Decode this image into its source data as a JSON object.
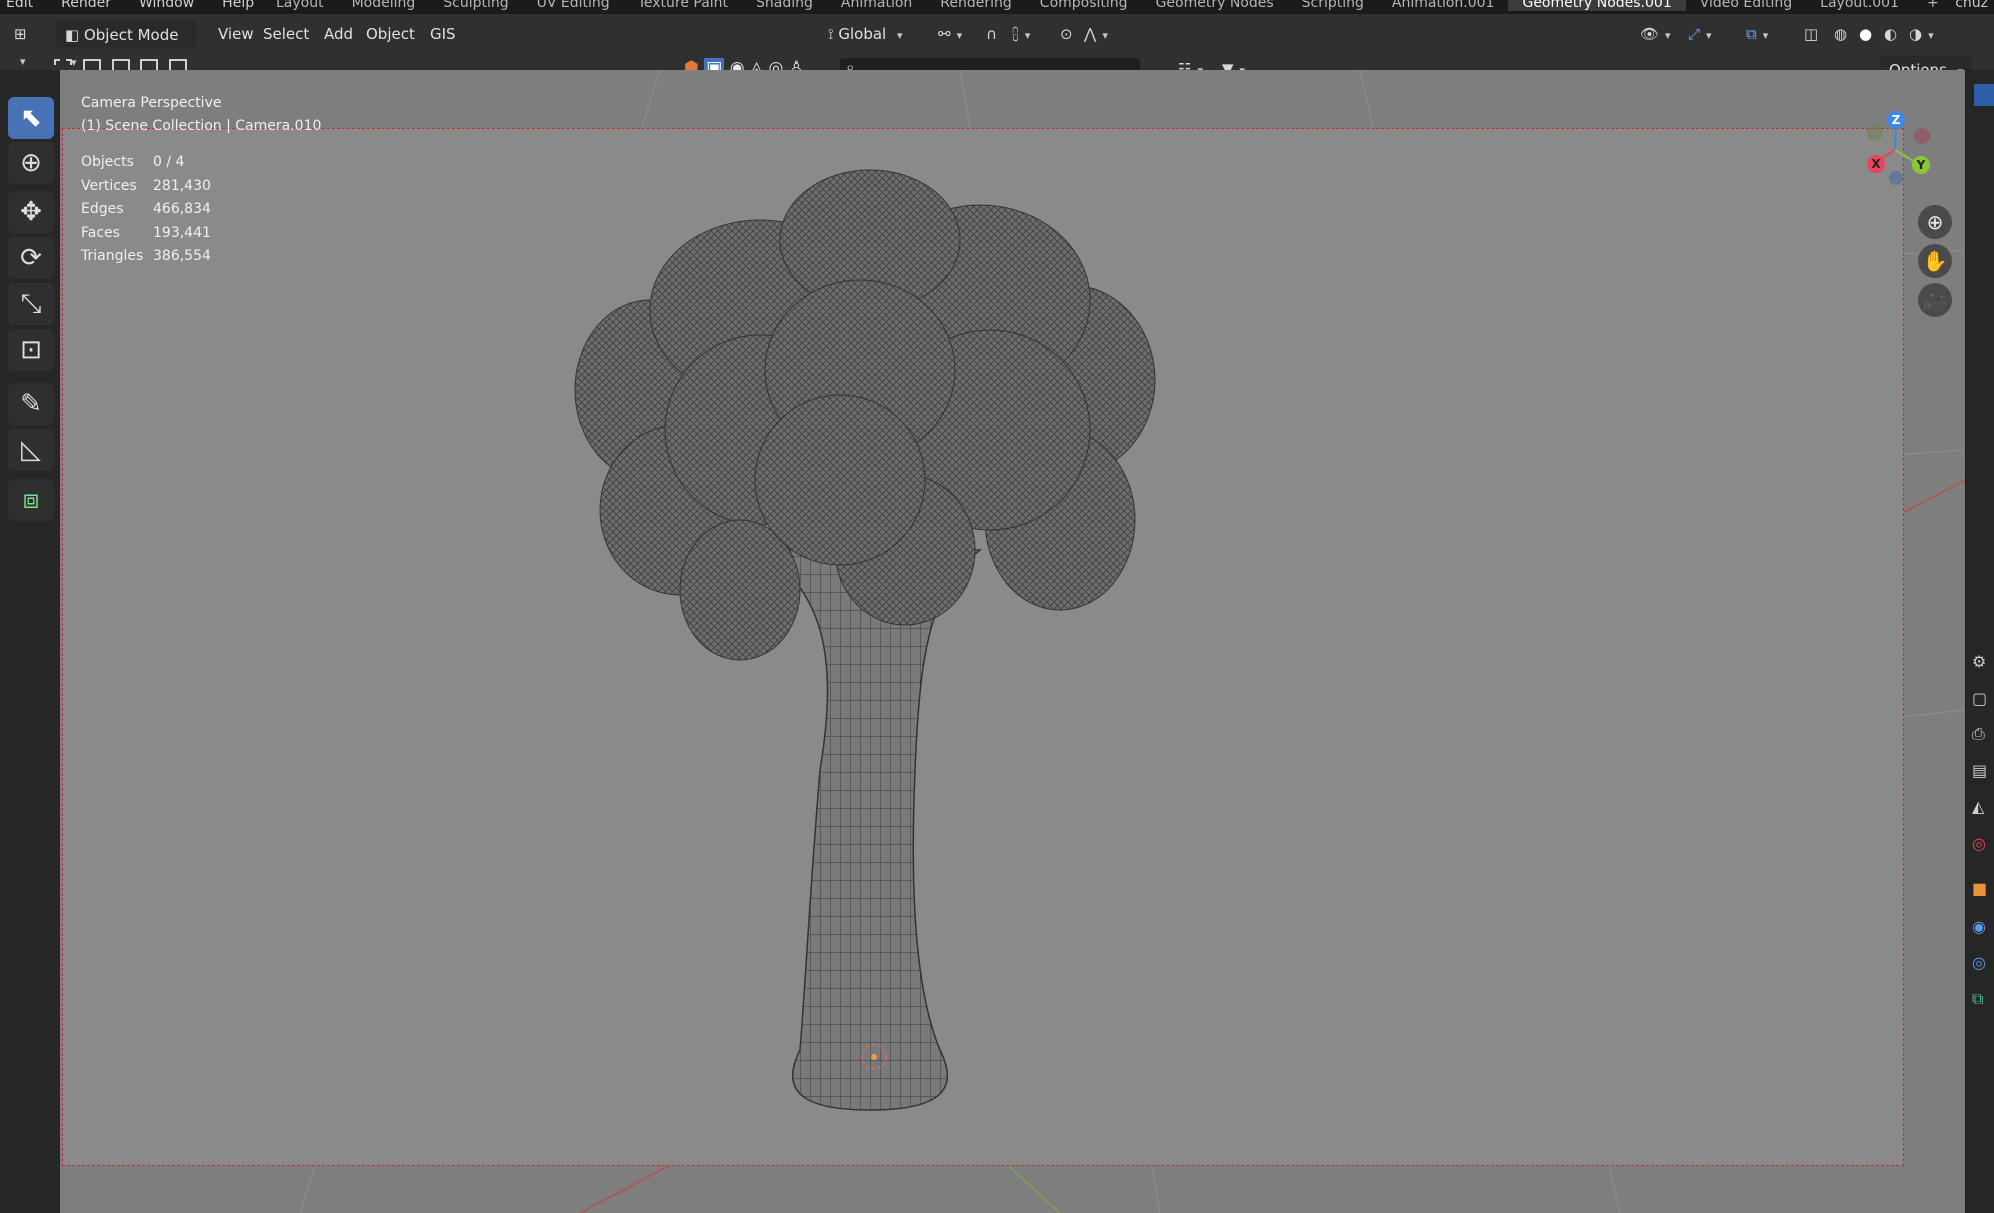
{
  "topbar": {
    "menus": [
      "Edit",
      "Render",
      "Window",
      "Help"
    ],
    "tabs": [
      "Layout",
      "Modeling",
      "Sculpting",
      "UV Editing",
      "Texture Paint",
      "Shading",
      "Animation",
      "Rendering",
      "Compositing",
      "Geometry Nodes",
      "Scripting",
      "Animation.001",
      "Geometry Nodes.001",
      "Video Editing",
      "Layout.001"
    ],
    "active_tab": "Geometry Nodes.001",
    "add_tab": "+",
    "corner": "chuz"
  },
  "header": {
    "mode": "Object Mode",
    "menu": [
      "View",
      "Select",
      "Add",
      "Object",
      "GIS"
    ],
    "transform_orientation": "Global",
    "options_label": "Options"
  },
  "viewport": {
    "view_name": "Camera Perspective",
    "collection_info": "(1) Scene Collection | Camera.010",
    "stats": [
      {
        "label": "Objects",
        "value": "0 / 4"
      },
      {
        "label": "Vertices",
        "value": "281,430"
      },
      {
        "label": "Edges",
        "value": "466,834"
      },
      {
        "label": "Faces",
        "value": "193,441"
      },
      {
        "label": "Triangles",
        "value": "386,554"
      }
    ]
  },
  "gizmo": {
    "x_label": "X",
    "y_label": "Y",
    "z_label": "Z",
    "x_color": "#e8435a",
    "y_color": "#8ac737",
    "z_color": "#3c87e8"
  },
  "colors": {
    "accent": "#4772b3",
    "camera_frame": "#b33333"
  }
}
